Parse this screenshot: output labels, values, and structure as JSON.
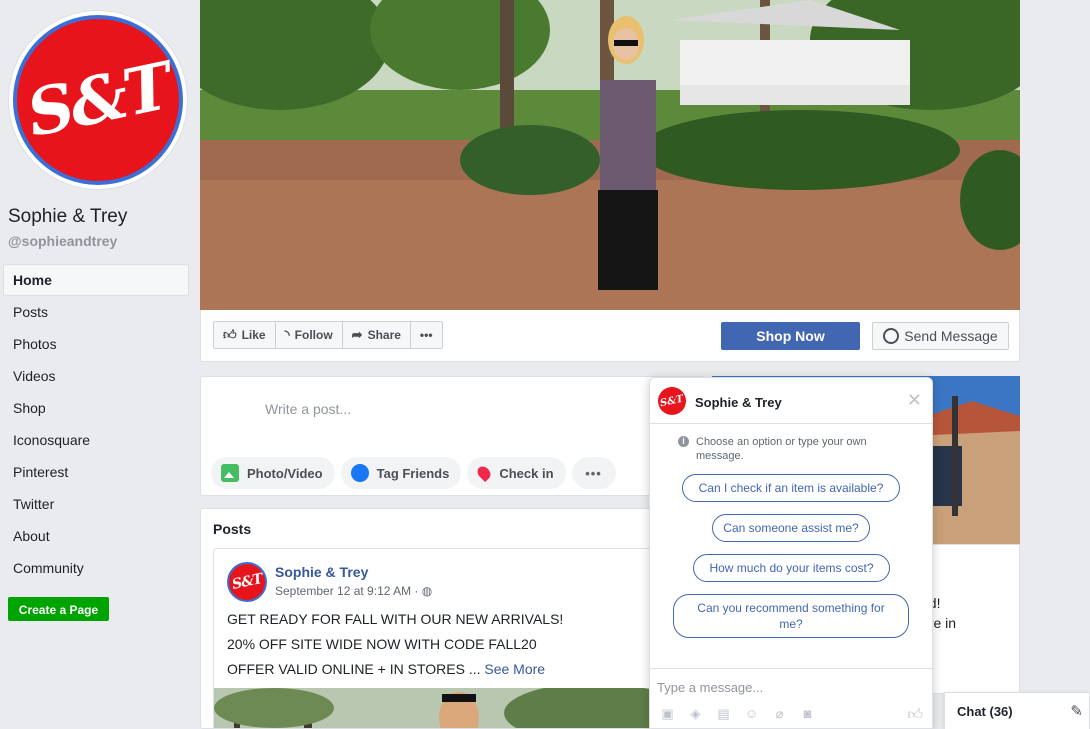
{
  "page": {
    "name": "Sophie & Trey",
    "handle": "@sophieandtrey",
    "logo_text": "S&T"
  },
  "nav": {
    "items": [
      "Home",
      "Posts",
      "Photos",
      "Videos",
      "Shop",
      "Iconosquare",
      "Pinterest",
      "Twitter",
      "About",
      "Community"
    ],
    "active": "Home",
    "create_label": "Create a Page"
  },
  "actions": {
    "like": "Like",
    "follow": "Follow",
    "share": "Share",
    "more": "•••",
    "shop_now": "Shop Now",
    "send_message": "Send Message"
  },
  "composer": {
    "placeholder": "Write a post...",
    "photo_video": "Photo/Video",
    "tag_friends": "Tag Friends",
    "check_in": "Check in",
    "more": "•••"
  },
  "posts": {
    "title": "Posts",
    "author": "Sophie & Trey",
    "timestamp": "September 12 at 9:12 AM · ",
    "lines": [
      "GET READY FOR FALL WITH OUR NEW ARRIVALS!",
      "20% OFF SITE WIDE NOW WITH CODE FALL20",
      "OFFER VALID ONLINE + IN STORES ... "
    ],
    "see_more": "See More"
  },
  "right_card": {
    "fragments": [
      "nd!",
      "ore in",
      "..."
    ]
  },
  "chat": {
    "name": "Sophie & Trey",
    "info": "Choose an option or type your own message.",
    "quick_replies": [
      "Can I check if an item is available?",
      "Can someone assist me?",
      "How much do your items cost?",
      "Can you recommend something for me?"
    ],
    "input_placeholder": "Type a message...",
    "close": "✕"
  },
  "chatbar": {
    "label": "Chat (36)"
  },
  "colors": {
    "brand_red": "#e8141b",
    "facebook_blue": "#4267b2",
    "create_green": "#00a400",
    "link_blue": "#365899"
  }
}
